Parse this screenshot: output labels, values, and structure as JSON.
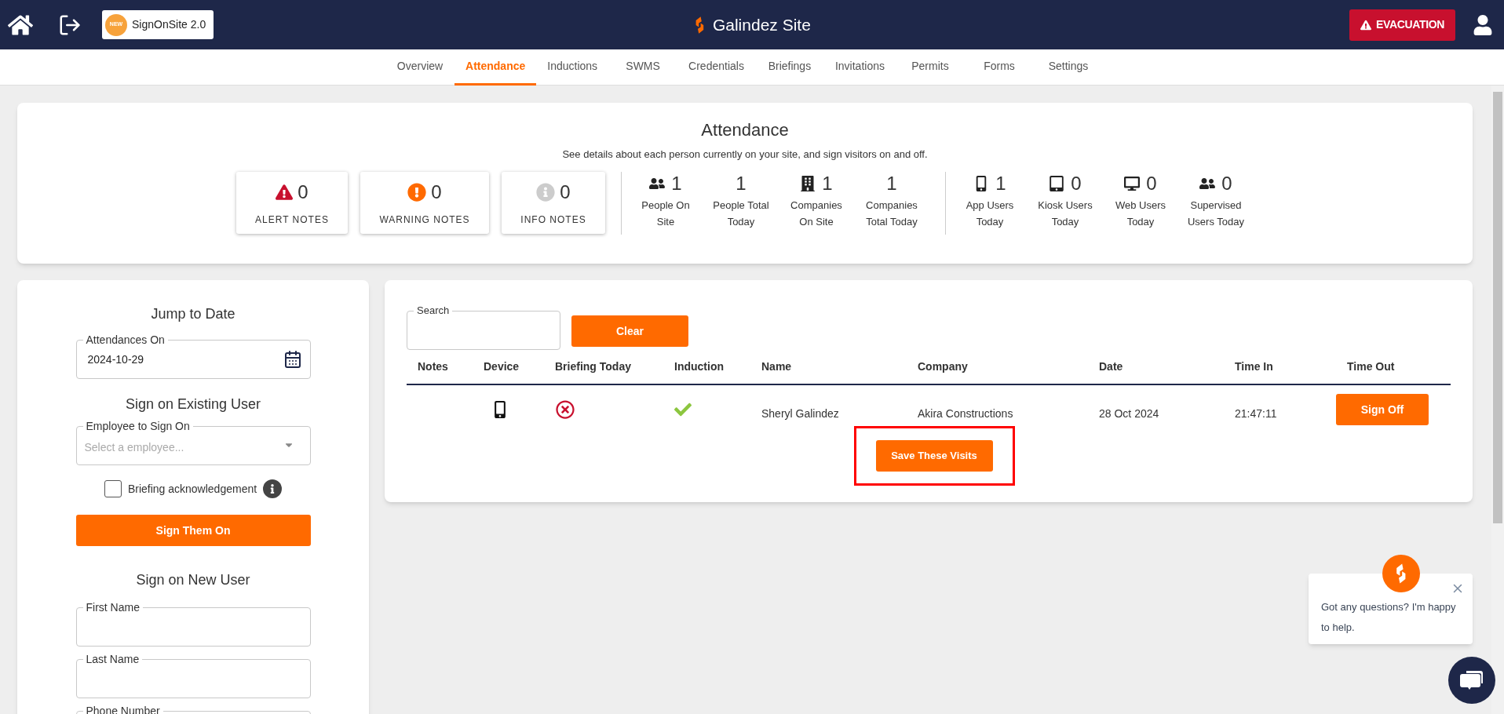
{
  "header": {
    "badge": {
      "tag": "NEW",
      "text": "SignOnSite 2.0"
    },
    "site_title": "Galindez Site",
    "evacuation_button": "EVACUATION"
  },
  "tabs": [
    {
      "label": "Overview",
      "selected": false
    },
    {
      "label": "Attendance",
      "selected": true
    },
    {
      "label": "Inductions",
      "selected": false
    },
    {
      "label": "SWMS",
      "selected": false
    },
    {
      "label": "Credentials",
      "selected": false
    },
    {
      "label": "Briefings",
      "selected": false
    },
    {
      "label": "Invitations",
      "selected": false
    },
    {
      "label": "Permits",
      "selected": false
    },
    {
      "label": "Forms",
      "selected": false
    },
    {
      "label": "Settings",
      "selected": false
    }
  ],
  "summary": {
    "title": "Attendance",
    "subtitle": "See details about each person currently on your site, and sign visitors on and off.",
    "note_cards": [
      {
        "kind": "alert",
        "count": "0",
        "label": "ALERT NOTES"
      },
      {
        "kind": "warning",
        "count": "0",
        "label": "WARNING NOTES"
      },
      {
        "kind": "info",
        "count": "0",
        "label": "INFO NOTES"
      }
    ],
    "stat_groups": [
      [
        {
          "kind": "people",
          "value": "1",
          "lines": [
            "People On",
            "Site"
          ]
        },
        {
          "kind": "total",
          "value": "1",
          "lines": [
            "People Total",
            "Today"
          ]
        },
        {
          "kind": "companies",
          "value": "1",
          "lines": [
            "Companies",
            "On Site"
          ]
        },
        {
          "kind": "total",
          "value": "1",
          "lines": [
            "Companies",
            "Total Today"
          ]
        }
      ],
      [
        {
          "kind": "app",
          "value": "1",
          "lines": [
            "App Users",
            "Today"
          ]
        },
        {
          "kind": "kiosk",
          "value": "0",
          "lines": [
            "Kiosk Users",
            "Today"
          ]
        },
        {
          "kind": "web",
          "value": "0",
          "lines": [
            "Web Users",
            "Today"
          ]
        },
        {
          "kind": "supervised",
          "value": "0",
          "lines": [
            "Supervised",
            "Users Today"
          ]
        }
      ]
    ]
  },
  "jump_to_date": {
    "title": "Jump to Date",
    "field": {
      "label": "Attendances On",
      "value": "2024-10-29"
    }
  },
  "existing_user": {
    "title": "Sign on Existing User",
    "select": {
      "label": "Employee to Sign On",
      "placeholder": "Select a employee..."
    },
    "checkbox": {
      "label": "Briefing acknowledgement",
      "checked": false
    },
    "button": "Sign Them On"
  },
  "new_user": {
    "title": "Sign on New User",
    "fields": [
      {
        "label": "First Name"
      },
      {
        "label": "Last Name"
      },
      {
        "label": "Phone Number"
      }
    ]
  },
  "visits": {
    "search": {
      "label": "Search"
    },
    "clear_button": "Clear",
    "columns": [
      "Notes",
      "Device",
      "Briefing Today",
      "Induction",
      "Name",
      "Company",
      "Date",
      "Time In",
      "Time Out"
    ],
    "rows": [
      {
        "kind": "app",
        "briefing_done": false,
        "inducted": true,
        "name": "Sheryl Galindez",
        "company": "Akira Constructions",
        "date": "28 Oct 2024",
        "time_in": "21:47:11",
        "action": "Sign Off"
      }
    ],
    "save_button": "Save These Visits",
    "save_highlighted": true
  },
  "chat": {
    "message": "Got any questions? I'm happy to help."
  }
}
